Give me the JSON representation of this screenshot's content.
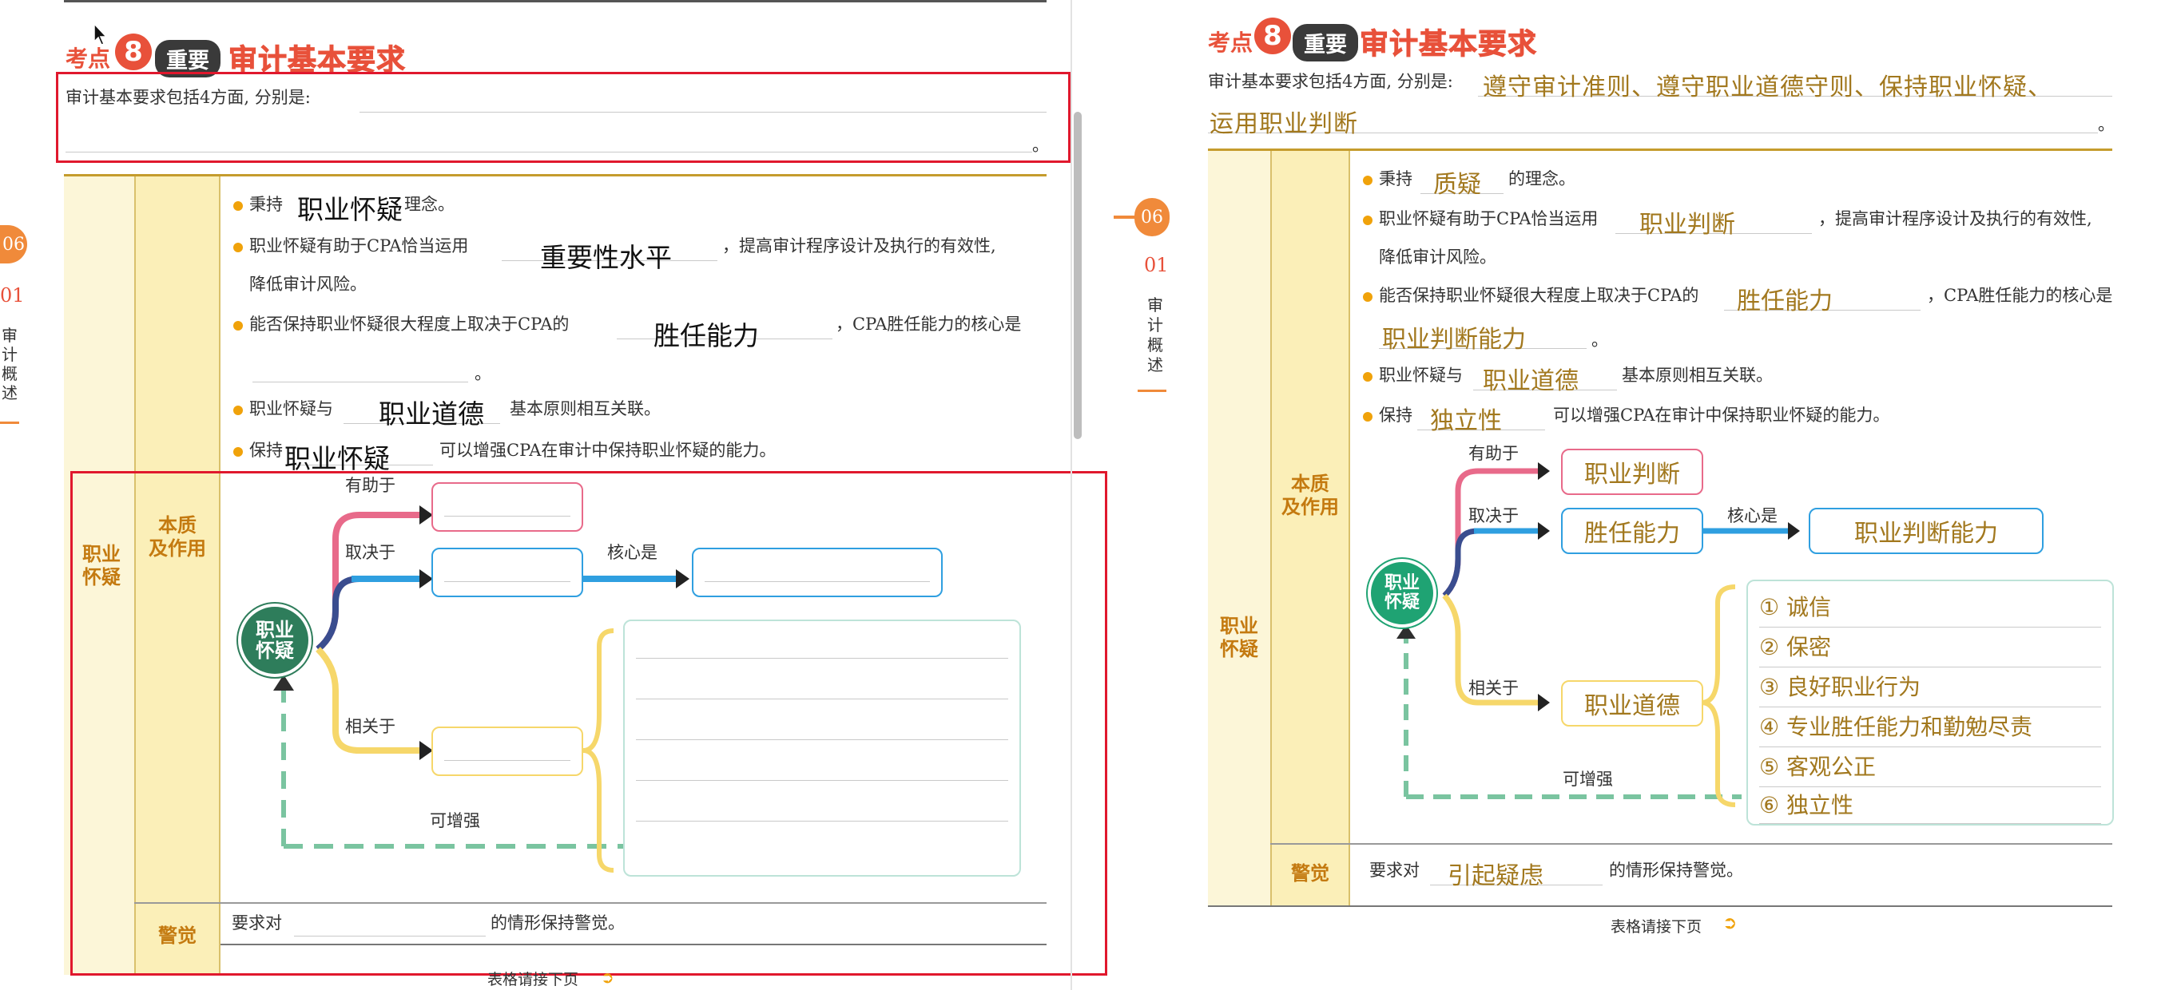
{
  "left": {
    "header": {
      "kaodian": "考点",
      "num": "8",
      "importance": "重要",
      "title": "审计基本要求"
    },
    "intro": "审计基本要求包括4方面, 分别是:",
    "period": "。",
    "side_tab": {
      "num": "06",
      "sub": "01",
      "chars": [
        "审",
        "计",
        "概",
        "述"
      ]
    },
    "rows": {
      "outer_label": "职业\n怀疑",
      "nature_label": "本质\n及作用",
      "alert_label": "警觉"
    },
    "bullets": [
      {
        "pre": "秉持",
        "ans": "职业怀疑",
        "post": "理念。"
      },
      {
        "pre": "职业怀疑有助于CPA恰当运用",
        "ans": "重要性水平",
        "post": "，提高审计程序设计及执行的有效性,"
      },
      {
        "cont": "降低审计风险。"
      },
      {
        "pre": "能否保持职业怀疑很大程度上取决于CPA的",
        "ans": "胜任能力",
        "post": "，CPA胜任能力的核心是"
      },
      {
        "cont": "。"
      },
      {
        "pre": "职业怀疑与",
        "ans": "职业道德",
        "post": "基本原则相互关联。"
      },
      {
        "pre": "保持",
        "ans": "职业怀疑",
        "post": "可以增强CPA在审计中保持职业怀疑的能力。"
      }
    ],
    "diagram": {
      "center": "职业\n怀疑",
      "helps": "有助于",
      "depends": "取决于",
      "core": "核心是",
      "relates": "相关于",
      "enhance": "可增强"
    },
    "alert_text_pre": "要求对",
    "alert_text_post": "的情形保持警觉。",
    "footer": "表格请接下页"
  },
  "right": {
    "header": {
      "kaodian": "考点",
      "num": "8",
      "importance": "重要",
      "title": "审计基本要求"
    },
    "intro": "审计基本要求包括4方面, 分别是:",
    "intro_ans1": "遵守审计准则、遵守职业道德守则、保持职业怀疑、",
    "intro_ans2": "运用职业判断",
    "period": "。",
    "side_tab": {
      "num": "06",
      "sub": "01",
      "chars": [
        "审",
        "计",
        "概",
        "述"
      ]
    },
    "rows": {
      "outer_label": "职业\n怀疑",
      "nature_label": "本质\n及作用",
      "alert_label": "警觉"
    },
    "bullets": [
      {
        "pre": "秉持",
        "ans": "质疑",
        "post": "的理念。"
      },
      {
        "pre": "职业怀疑有助于CPA恰当运用",
        "ans": "职业判断",
        "post": "，提高审计程序设计及执行的有效性,"
      },
      {
        "cont": "降低审计风险。"
      },
      {
        "pre": "能否保持职业怀疑很大程度上取决于CPA的",
        "ans": "胜任能力",
        "post": "，CPA胜任能力的核心是"
      },
      {
        "ans": "职业判断能力",
        "post": "。"
      },
      {
        "pre": "职业怀疑与",
        "ans": "职业道德",
        "post": "基本原则相互关联。"
      },
      {
        "pre": "保持",
        "ans": "独立性",
        "post": "可以增强CPA在审计中保持职业怀疑的能力。"
      }
    ],
    "diagram": {
      "center": "职业\n怀疑",
      "helps": "有助于",
      "depends": "取决于",
      "core": "核心是",
      "relates": "相关于",
      "enhance": "可增强",
      "box_helps": "职业判断",
      "box_depends": "胜任能力",
      "box_core": "职业判断能力",
      "box_relates": "职业道德",
      "principles": [
        "① 诚信",
        "② 保密",
        "③ 良好职业行为",
        "④ 专业胜任能力和勤勉尽责",
        "⑤ 客观公正",
        "⑥ 独立性"
      ]
    },
    "alert_text_pre": "要求对",
    "alert_ans": "引起疑虑",
    "alert_text_post": "的情形保持警觉。",
    "footer": "表格请接下页"
  },
  "colors": {
    "accent": "#e8513a",
    "highlight_box": "#e0182d",
    "pink": "#e86a8a",
    "blue": "#2f9fe0",
    "yellow": "#f6d76a",
    "green": "#3fae84",
    "dark_green": "#2e7d5b"
  }
}
